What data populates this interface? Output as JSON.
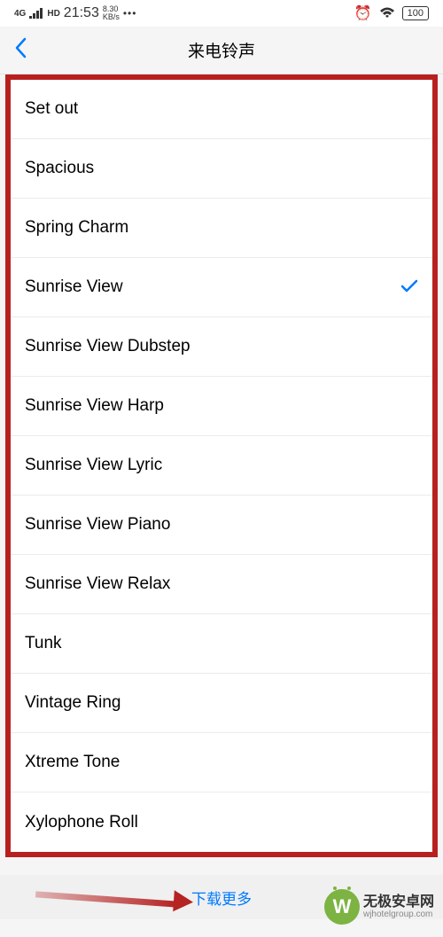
{
  "statusBar": {
    "network": "4G",
    "hd": "HD",
    "time": "21:53",
    "speedValue": "8.30",
    "speedUnit": "KB/s",
    "battery": "100"
  },
  "nav": {
    "title": "来电铃声"
  },
  "ringtones": [
    {
      "label": "Set out",
      "selected": false
    },
    {
      "label": "Spacious",
      "selected": false
    },
    {
      "label": "Spring Charm",
      "selected": false
    },
    {
      "label": "Sunrise View",
      "selected": true
    },
    {
      "label": "Sunrise View Dubstep",
      "selected": false
    },
    {
      "label": "Sunrise View Harp",
      "selected": false
    },
    {
      "label": "Sunrise View Lyric",
      "selected": false
    },
    {
      "label": "Sunrise View Piano",
      "selected": false
    },
    {
      "label": "Sunrise View Relax",
      "selected": false
    },
    {
      "label": "Tunk",
      "selected": false
    },
    {
      "label": "Vintage Ring",
      "selected": false
    },
    {
      "label": "Xtreme Tone",
      "selected": false
    },
    {
      "label": "Xylophone Roll",
      "selected": false
    }
  ],
  "footer": {
    "downloadMore": "下载更多"
  },
  "watermark": {
    "logo": "W",
    "title": "无极安卓网",
    "subtitle": "wjhotelgroup.com"
  }
}
